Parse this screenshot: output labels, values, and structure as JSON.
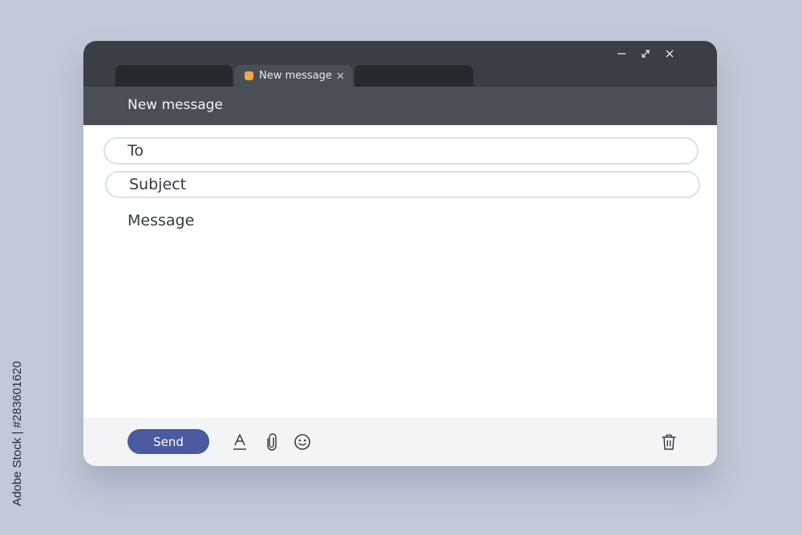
{
  "window": {
    "controls": {
      "minimize_icon": "minimize-icon",
      "maximize_icon": "expand-icon",
      "close_icon": "close-icon"
    },
    "tabs": [
      {
        "label": "",
        "state": "inactive"
      },
      {
        "label": "New message",
        "state": "active",
        "favicon_color": "#f2a93b"
      },
      {
        "label": "",
        "state": "inactive"
      }
    ]
  },
  "header": {
    "title": "New message"
  },
  "compose": {
    "to_placeholder": "To",
    "subject_placeholder": "Subject",
    "message_placeholder": "Message"
  },
  "footer": {
    "send_label": "Send",
    "tools": [
      "text-format-icon",
      "paperclip-icon",
      "emoji-icon"
    ],
    "delete_icon": "trash-icon"
  },
  "watermark": {
    "text": "Adobe Stock | #283601620"
  },
  "colors": {
    "background": "#c2cad9",
    "titlebar": "#3a3e45",
    "header": "#4a4f57",
    "accent": "#4c5a9f",
    "favicon": "#f2a93b"
  }
}
